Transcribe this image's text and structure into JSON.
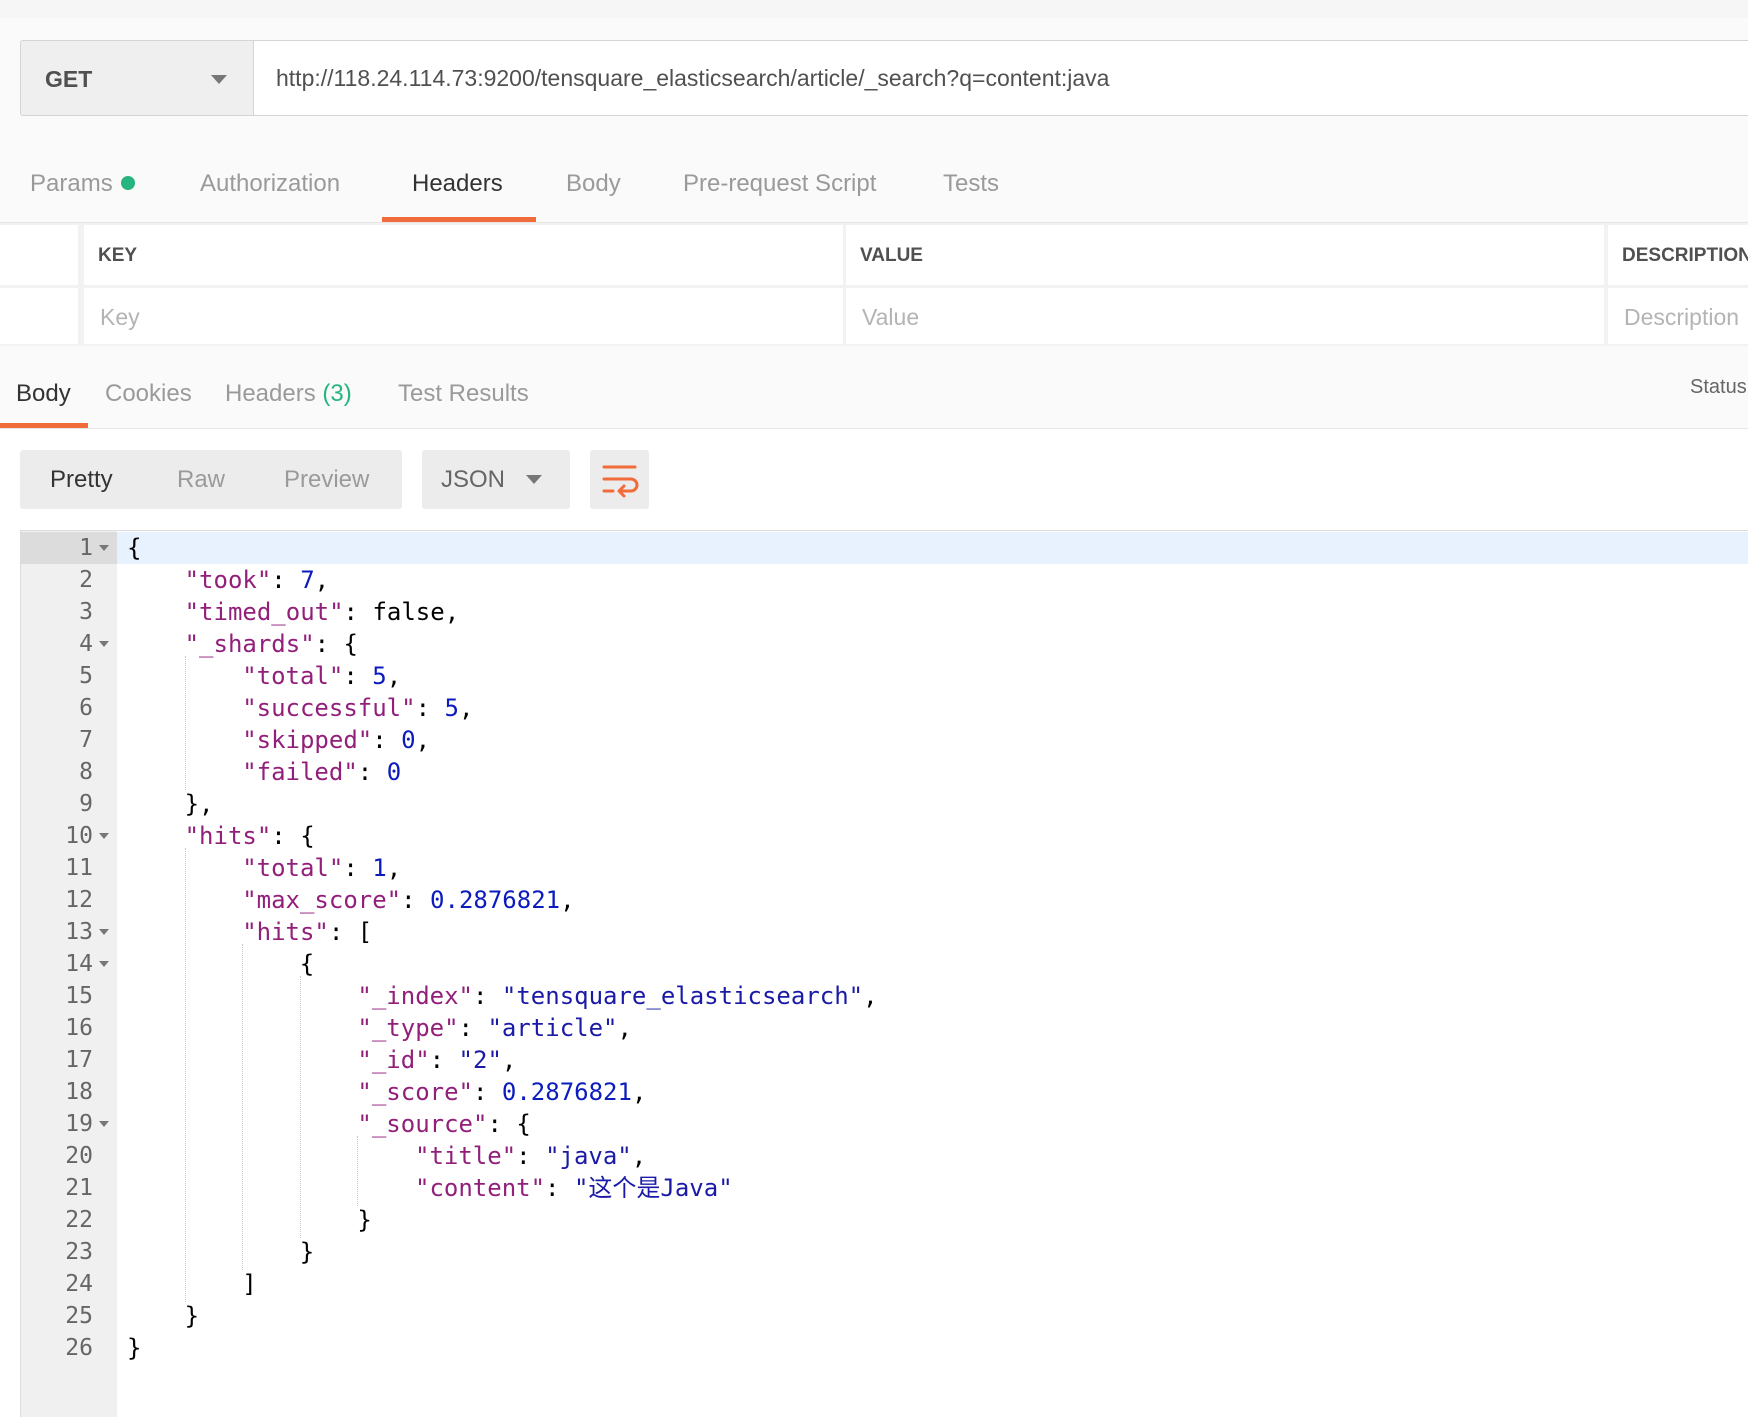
{
  "request": {
    "method": "GET",
    "url": "http://118.24.114.73:9200/tensquare_elasticsearch/article/_search?q=content:java"
  },
  "request_tabs": [
    {
      "label": "Params",
      "has_dot": true
    },
    {
      "label": "Authorization"
    },
    {
      "label": "Headers"
    },
    {
      "label": "Body"
    },
    {
      "label": "Pre-request Script"
    },
    {
      "label": "Tests"
    }
  ],
  "active_request_tab": "Headers",
  "headers_table": {
    "columns": [
      "KEY",
      "VALUE",
      "DESCRIPTION"
    ],
    "placeholders": [
      "Key",
      "Value",
      "Description"
    ]
  },
  "response": {
    "tabs": [
      {
        "label": "Body"
      },
      {
        "label": "Cookies"
      },
      {
        "label": "Headers",
        "count": "(3)"
      },
      {
        "label": "Test Results"
      }
    ],
    "active_tab": "Body",
    "status_label": "Status"
  },
  "view": {
    "modes": [
      "Pretty",
      "Raw",
      "Preview"
    ],
    "active_mode": "Pretty",
    "format": "JSON"
  },
  "colors": {
    "accent": "#f26b3a",
    "dot_green": "#26b47f",
    "json_key": "#92207b",
    "json_string": "#1a1aa6",
    "json_number": "#0b1bbd"
  },
  "editor": {
    "lines": [
      {
        "n": "1",
        "fold": true,
        "indent": 0,
        "tokens": [
          [
            "p",
            "{"
          ]
        ]
      },
      {
        "n": "2",
        "indent": 1,
        "tokens": [
          [
            "k",
            "\"took\""
          ],
          [
            "p",
            ": "
          ],
          [
            "n",
            "7"
          ],
          [
            "p",
            ","
          ]
        ]
      },
      {
        "n": "3",
        "indent": 1,
        "tokens": [
          [
            "k",
            "\"timed_out\""
          ],
          [
            "p",
            ": false,"
          ]
        ]
      },
      {
        "n": "4",
        "fold": true,
        "indent": 1,
        "tokens": [
          [
            "k",
            "\"_shards\""
          ],
          [
            "p",
            ": {"
          ]
        ]
      },
      {
        "n": "5",
        "indent": 2,
        "tokens": [
          [
            "k",
            "\"total\""
          ],
          [
            "p",
            ": "
          ],
          [
            "n",
            "5"
          ],
          [
            "p",
            ","
          ]
        ]
      },
      {
        "n": "6",
        "indent": 2,
        "tokens": [
          [
            "k",
            "\"successful\""
          ],
          [
            "p",
            ": "
          ],
          [
            "n",
            "5"
          ],
          [
            "p",
            ","
          ]
        ]
      },
      {
        "n": "7",
        "indent": 2,
        "tokens": [
          [
            "k",
            "\"skipped\""
          ],
          [
            "p",
            ": "
          ],
          [
            "n",
            "0"
          ],
          [
            "p",
            ","
          ]
        ]
      },
      {
        "n": "8",
        "indent": 2,
        "tokens": [
          [
            "k",
            "\"failed\""
          ],
          [
            "p",
            ": "
          ],
          [
            "n",
            "0"
          ]
        ]
      },
      {
        "n": "9",
        "indent": 1,
        "tokens": [
          [
            "p",
            "},"
          ]
        ]
      },
      {
        "n": "10",
        "fold": true,
        "indent": 1,
        "tokens": [
          [
            "k",
            "\"hits\""
          ],
          [
            "p",
            ": {"
          ]
        ]
      },
      {
        "n": "11",
        "indent": 2,
        "tokens": [
          [
            "k",
            "\"total\""
          ],
          [
            "p",
            ": "
          ],
          [
            "n",
            "1"
          ],
          [
            "p",
            ","
          ]
        ]
      },
      {
        "n": "12",
        "indent": 2,
        "tokens": [
          [
            "k",
            "\"max_score\""
          ],
          [
            "p",
            ": "
          ],
          [
            "n",
            "0.2876821"
          ],
          [
            "p",
            ","
          ]
        ]
      },
      {
        "n": "13",
        "fold": true,
        "indent": 2,
        "tokens": [
          [
            "k",
            "\"hits\""
          ],
          [
            "p",
            ": ["
          ]
        ]
      },
      {
        "n": "14",
        "fold": true,
        "indent": 3,
        "tokens": [
          [
            "p",
            "{"
          ]
        ]
      },
      {
        "n": "15",
        "indent": 4,
        "tokens": [
          [
            "k",
            "\"_index\""
          ],
          [
            "p",
            ": "
          ],
          [
            "s",
            "\"tensquare_elasticsearch\""
          ],
          [
            "p",
            ","
          ]
        ]
      },
      {
        "n": "16",
        "indent": 4,
        "tokens": [
          [
            "k",
            "\"_type\""
          ],
          [
            "p",
            ": "
          ],
          [
            "s",
            "\"article\""
          ],
          [
            "p",
            ","
          ]
        ]
      },
      {
        "n": "17",
        "indent": 4,
        "tokens": [
          [
            "k",
            "\"_id\""
          ],
          [
            "p",
            ": "
          ],
          [
            "s",
            "\"2\""
          ],
          [
            "p",
            ","
          ]
        ]
      },
      {
        "n": "18",
        "indent": 4,
        "tokens": [
          [
            "k",
            "\"_score\""
          ],
          [
            "p",
            ": "
          ],
          [
            "n",
            "0.2876821"
          ],
          [
            "p",
            ","
          ]
        ]
      },
      {
        "n": "19",
        "fold": true,
        "indent": 4,
        "tokens": [
          [
            "k",
            "\"_source\""
          ],
          [
            "p",
            ": {"
          ]
        ]
      },
      {
        "n": "20",
        "indent": 5,
        "tokens": [
          [
            "k",
            "\"title\""
          ],
          [
            "p",
            ": "
          ],
          [
            "s",
            "\"java\""
          ],
          [
            "p",
            ","
          ]
        ]
      },
      {
        "n": "21",
        "indent": 5,
        "tokens": [
          [
            "k",
            "\"content\""
          ],
          [
            "p",
            ": "
          ],
          [
            "s",
            "\"这个是Java\""
          ]
        ]
      },
      {
        "n": "22",
        "indent": 4,
        "tokens": [
          [
            "p",
            "}"
          ]
        ]
      },
      {
        "n": "23",
        "indent": 3,
        "tokens": [
          [
            "p",
            "}"
          ]
        ]
      },
      {
        "n": "24",
        "indent": 2,
        "tokens": [
          [
            "p",
            "]"
          ]
        ]
      },
      {
        "n": "25",
        "indent": 1,
        "tokens": [
          [
            "p",
            "}"
          ]
        ]
      },
      {
        "n": "26",
        "indent": 0,
        "tokens": [
          [
            "p",
            "}"
          ]
        ]
      }
    ]
  }
}
